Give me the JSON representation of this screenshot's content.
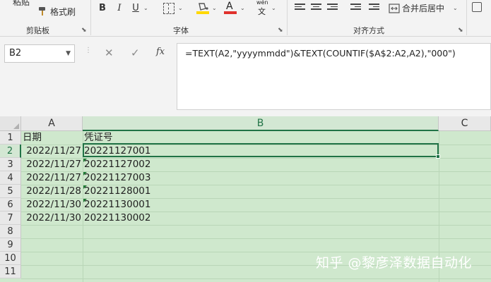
{
  "ribbon": {
    "paste_label": "粘贴",
    "format_painter_label": "格式刷",
    "font_color": "#e0312c",
    "highlight_color": "#ffd800",
    "font_buttons": {
      "bold": "B",
      "italic": "I",
      "underline": "U",
      "phonetic": "wén",
      "phonetic_sub": "文"
    },
    "merge_center_label": "合并后居中",
    "groups": {
      "clipboard": "剪贴板",
      "font": "字体",
      "alignment": "对齐方式"
    }
  },
  "formula_bar": {
    "name_box": "B2",
    "cancel_symbol": "✕",
    "enter_symbol": "✓",
    "fx_symbol": "fx",
    "formula": "=TEXT(A2,\"yyyymmdd\")&TEXT(COUNTIF($A$2:A2,A2),\"000\")"
  },
  "sheet": {
    "columns": [
      "A",
      "B",
      "C"
    ],
    "row_numbers": [
      "1",
      "2",
      "3",
      "4",
      "5",
      "6",
      "7",
      "8",
      "9",
      "10",
      "11"
    ],
    "header_row": {
      "a": "日期",
      "b": "凭证号"
    },
    "rows": [
      {
        "a": "2022/11/27",
        "b": "20221127001"
      },
      {
        "a": "2022/11/27",
        "b": "20221127002"
      },
      {
        "a": "2022/11/27",
        "b": "20221127003"
      },
      {
        "a": "2022/11/28",
        "b": "20221128001"
      },
      {
        "a": "2022/11/30",
        "b": "20221130001"
      },
      {
        "a": "2022/11/30",
        "b": "20221130002"
      }
    ],
    "selected_cell": "B2",
    "accent_color": "#217346",
    "grid_background": "#cfe8cd"
  },
  "watermark": "知乎 @黎彦泽数据自动化"
}
